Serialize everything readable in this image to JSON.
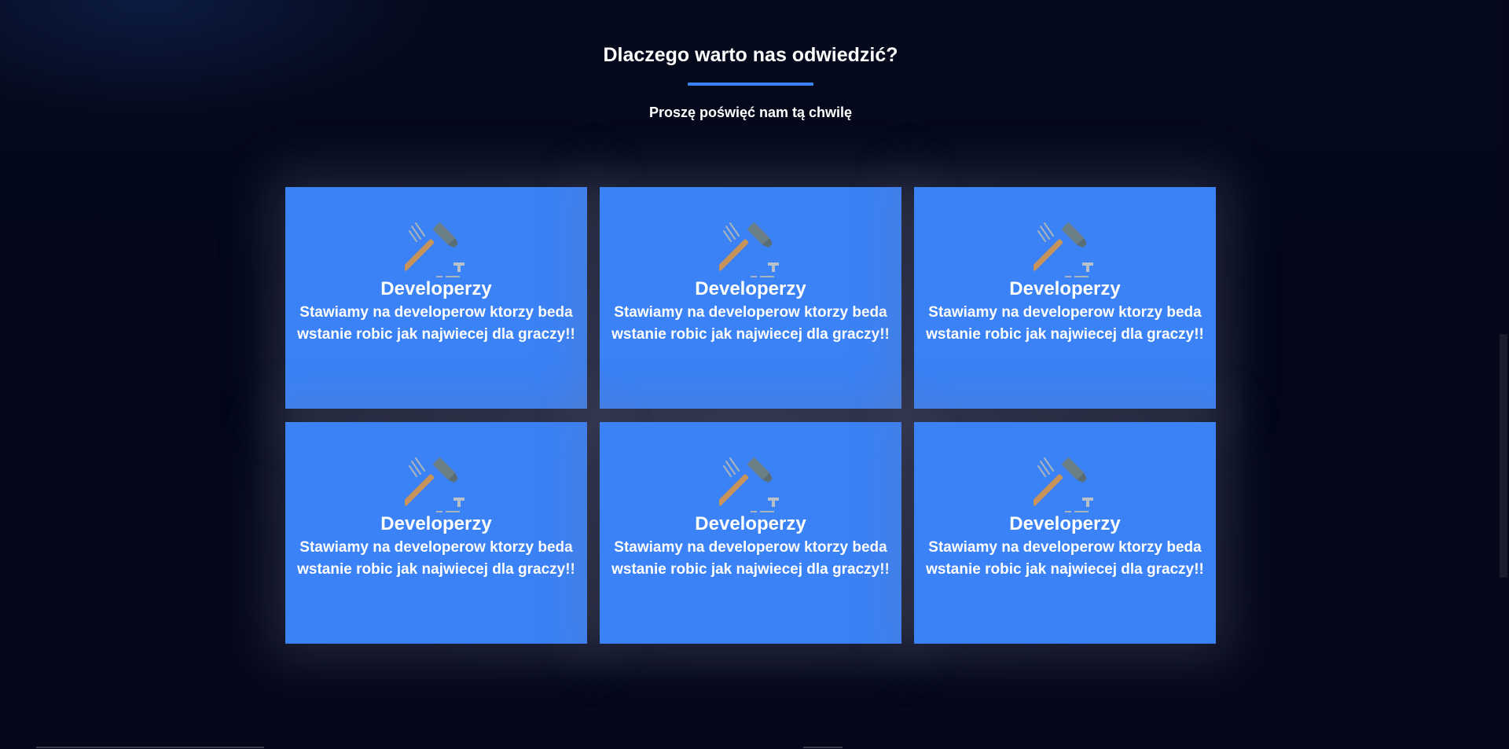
{
  "section": {
    "title": "Dlaczego warto nas odwiedzić?",
    "subtitle": "Proszę poświęć nam tą chwilę"
  },
  "colors": {
    "accent": "#3b82f6",
    "background": "#05081a",
    "card": "#3b82f6",
    "text": "#ffffff"
  },
  "cards": [
    {
      "icon": "hammer-icon",
      "title": "Developerzy",
      "text": "Stawiamy na developerow ktorzy beda wstanie robic jak najwiecej dla graczy!!"
    },
    {
      "icon": "hammer-icon",
      "title": "Developerzy",
      "text": "Stawiamy na developerow ktorzy beda wstanie robic jak najwiecej dla graczy!!"
    },
    {
      "icon": "hammer-icon",
      "title": "Developerzy",
      "text": "Stawiamy na developerow ktorzy beda wstanie robic jak najwiecej dla graczy!!"
    },
    {
      "icon": "hammer-icon",
      "title": "Developerzy",
      "text": "Stawiamy na developerow ktorzy beda wstanie robic jak najwiecej dla graczy!!"
    },
    {
      "icon": "hammer-icon",
      "title": "Developerzy",
      "text": "Stawiamy na developerow ktorzy beda wstanie robic jak najwiecej dla graczy!!"
    },
    {
      "icon": "hammer-icon",
      "title": "Developerzy",
      "text": "Stawiamy na developerow ktorzy beda wstanie robic jak najwiecej dla graczy!!"
    }
  ]
}
